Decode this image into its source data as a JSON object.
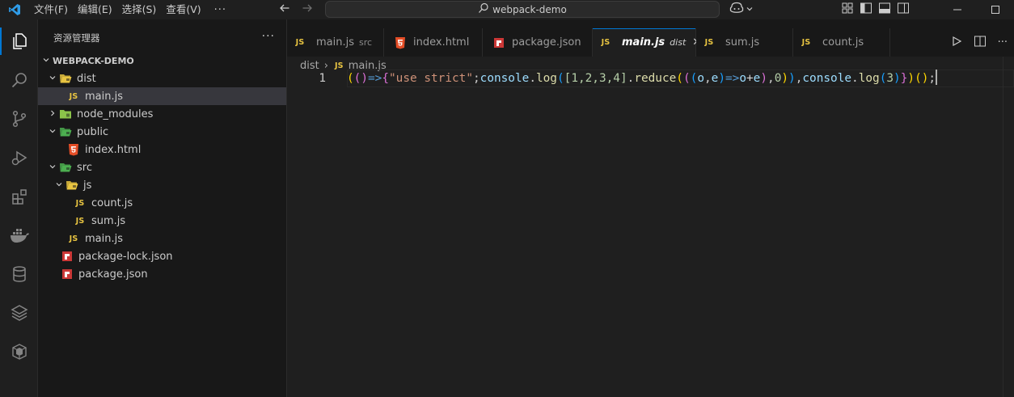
{
  "titlebar": {
    "menus": [
      "文件(F)",
      "编辑(E)",
      "选择(S)",
      "查看(V)"
    ],
    "more": "···",
    "search_text": "webpack-demo"
  },
  "sidebar": {
    "title": "资源管理器",
    "more": "···",
    "root": "WEBPACK-DEMO",
    "tree": [
      {
        "label": "dist",
        "depth": 1,
        "kind": "folder-open",
        "icon_color": "#e8c441"
      },
      {
        "label": "main.js",
        "depth": 2,
        "kind": "js",
        "selected": true
      },
      {
        "label": "node_modules",
        "depth": 1,
        "kind": "folder-closed",
        "icon_color": "#8bc34a"
      },
      {
        "label": "public",
        "depth": 1,
        "kind": "folder-open",
        "icon_color": "#4caf50"
      },
      {
        "label": "index.html",
        "depth": 2,
        "kind": "html"
      },
      {
        "label": "src",
        "depth": 1,
        "kind": "folder-open",
        "icon_color": "#4caf50"
      },
      {
        "label": "js",
        "depth": 2,
        "kind": "folder-open",
        "icon_color": "#e8c441"
      },
      {
        "label": "count.js",
        "depth": 3,
        "kind": "js"
      },
      {
        "label": "sum.js",
        "depth": 3,
        "kind": "js"
      },
      {
        "label": "main.js",
        "depth": 2,
        "kind": "js"
      },
      {
        "label": "package-lock.json",
        "depth": 1,
        "kind": "npm"
      },
      {
        "label": "package.json",
        "depth": 1,
        "kind": "npm"
      }
    ]
  },
  "icons": {
    "js": "JS",
    "chevron_down": "⌄",
    "chevron_right": "›"
  },
  "tabs": [
    {
      "name": "main.js",
      "desc": "src",
      "kind": "js",
      "active": false
    },
    {
      "name": "index.html",
      "desc": "",
      "kind": "html",
      "active": false
    },
    {
      "name": "package.json",
      "desc": "",
      "kind": "npm",
      "active": false
    },
    {
      "name": "main.js",
      "desc": "dist",
      "kind": "js",
      "active": true,
      "close": "✕"
    },
    {
      "name": "sum.js",
      "desc": "",
      "kind": "js",
      "active": false
    },
    {
      "name": "count.js",
      "desc": "",
      "kind": "js",
      "active": false
    }
  ],
  "breadcrumb": {
    "folder": "dist",
    "separator": "›",
    "file": "main.js"
  },
  "code": {
    "line_number": "1",
    "tokens": [
      {
        "t": "(",
        "c": "#ffd700"
      },
      {
        "t": "(",
        "c": "#da70d6"
      },
      {
        "t": ")",
        "c": "#da70d6"
      },
      {
        "t": "=>",
        "c": "#569cd6"
      },
      {
        "t": "{",
        "c": "#da70d6"
      },
      {
        "t": "\"use strict\"",
        "c": "#ce9178"
      },
      {
        "t": ";",
        "c": "#cccccc"
      },
      {
        "t": "console",
        "c": "#9cdcfe"
      },
      {
        "t": ".",
        "c": "#cccccc"
      },
      {
        "t": "log",
        "c": "#dcdcaa"
      },
      {
        "t": "(",
        "c": "#179fff"
      },
      {
        "t": "[1,2,3,4]",
        "c": "#b5cea8"
      },
      {
        "t": ".",
        "c": "#cccccc"
      },
      {
        "t": "reduce",
        "c": "#dcdcaa"
      },
      {
        "t": "(",
        "c": "#ffd700"
      },
      {
        "t": "(",
        "c": "#da70d6"
      },
      {
        "t": "(",
        "c": "#179fff"
      },
      {
        "t": "o",
        "c": "#9cdcfe"
      },
      {
        "t": ",",
        "c": "#cccccc"
      },
      {
        "t": "e",
        "c": "#9cdcfe"
      },
      {
        "t": ")",
        "c": "#179fff"
      },
      {
        "t": "=>",
        "c": "#569cd6"
      },
      {
        "t": "o",
        "c": "#9cdcfe"
      },
      {
        "t": "+",
        "c": "#d4d4d4"
      },
      {
        "t": "e",
        "c": "#9cdcfe"
      },
      {
        "t": ")",
        "c": "#da70d6"
      },
      {
        "t": ",",
        "c": "#cccccc"
      },
      {
        "t": "0",
        "c": "#b5cea8"
      },
      {
        "t": ")",
        "c": "#ffd700"
      },
      {
        "t": ")",
        "c": "#179fff"
      },
      {
        "t": ",",
        "c": "#cccccc"
      },
      {
        "t": "console",
        "c": "#9cdcfe"
      },
      {
        "t": ".",
        "c": "#cccccc"
      },
      {
        "t": "log",
        "c": "#dcdcaa"
      },
      {
        "t": "(",
        "c": "#179fff"
      },
      {
        "t": "3",
        "c": "#b5cea8"
      },
      {
        "t": ")",
        "c": "#179fff"
      },
      {
        "t": "}",
        "c": "#da70d6"
      },
      {
        "t": ")",
        "c": "#ffd700"
      },
      {
        "t": "(",
        "c": "#ffd700"
      },
      {
        "t": ")",
        "c": "#ffd700"
      },
      {
        "t": ";",
        "c": "#cccccc"
      }
    ]
  },
  "colors": {
    "accent": "#0078d4",
    "js": "#e8c441",
    "html": "#e44d26",
    "npm": "#cb3837"
  }
}
